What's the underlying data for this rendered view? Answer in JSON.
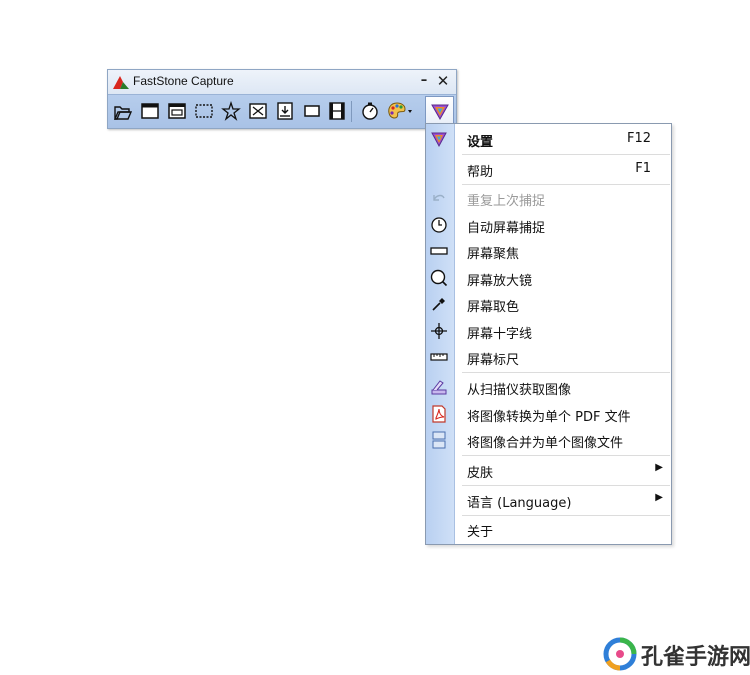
{
  "window": {
    "title": "FastStone Capture",
    "minimize": "–",
    "close": "✕"
  },
  "toolbar": {
    "buttons": [
      {
        "name": "open-file",
        "icon": "folder-open-icon"
      },
      {
        "name": "capture-active-window",
        "icon": "window-icon"
      },
      {
        "name": "capture-window-object",
        "icon": "window-object-icon"
      },
      {
        "name": "capture-rectangle",
        "icon": "dotted-rectangle-icon"
      },
      {
        "name": "capture-freehand",
        "icon": "freehand-star-icon"
      },
      {
        "name": "capture-full-screen",
        "icon": "full-screen-icon"
      },
      {
        "name": "capture-scrolling",
        "icon": "scrolling-window-icon"
      },
      {
        "name": "capture-fixed-region",
        "icon": "fixed-region-icon"
      },
      {
        "name": "screen-recorder",
        "icon": "film-icon"
      },
      {
        "name": "delay-capture",
        "icon": "stopwatch-icon"
      },
      {
        "name": "output-color",
        "icon": "palette-icon"
      },
      {
        "name": "settings-menu",
        "icon": "faststone-menu-icon"
      }
    ]
  },
  "menu": {
    "items": [
      {
        "label": "设置",
        "shortcut": "F12",
        "icon": "settings-icon",
        "bold": true
      },
      {
        "label": "帮助",
        "shortcut": "F1"
      },
      {
        "label": "重复上次捕捉",
        "icon": "repeat-icon",
        "disabled": true
      },
      {
        "label": "自动屏幕捕捉",
        "icon": "clock-icon"
      },
      {
        "label": "屏幕聚焦",
        "icon": "rectangle-icon"
      },
      {
        "label": "屏幕放大镜",
        "icon": "magnifier-icon"
      },
      {
        "label": "屏幕取色",
        "icon": "eyedropper-icon"
      },
      {
        "label": "屏幕十字线",
        "icon": "crosshair-icon"
      },
      {
        "label": "屏幕标尺",
        "icon": "ruler-icon"
      },
      {
        "label": "从扫描仪获取图像",
        "icon": "scanner-icon"
      },
      {
        "label": "将图像转换为单个 PDF 文件",
        "icon": "pdf-icon"
      },
      {
        "label": "将图像合并为单个图像文件",
        "icon": "combine-images-icon"
      },
      {
        "label": "皮肤",
        "submenu": "▶"
      },
      {
        "label": "语言 (Language)",
        "submenu": "▶"
      },
      {
        "label": "关于"
      }
    ]
  },
  "watermark": {
    "text": "孔雀手游网"
  },
  "colors": {
    "toolbar_bg": "#afc7e9",
    "menu_gutter": "#c4d8f4",
    "disabled_text": "#9a9a9a",
    "watermark_blue": "#2f7fd8",
    "watermark_green": "#3ab54a"
  }
}
